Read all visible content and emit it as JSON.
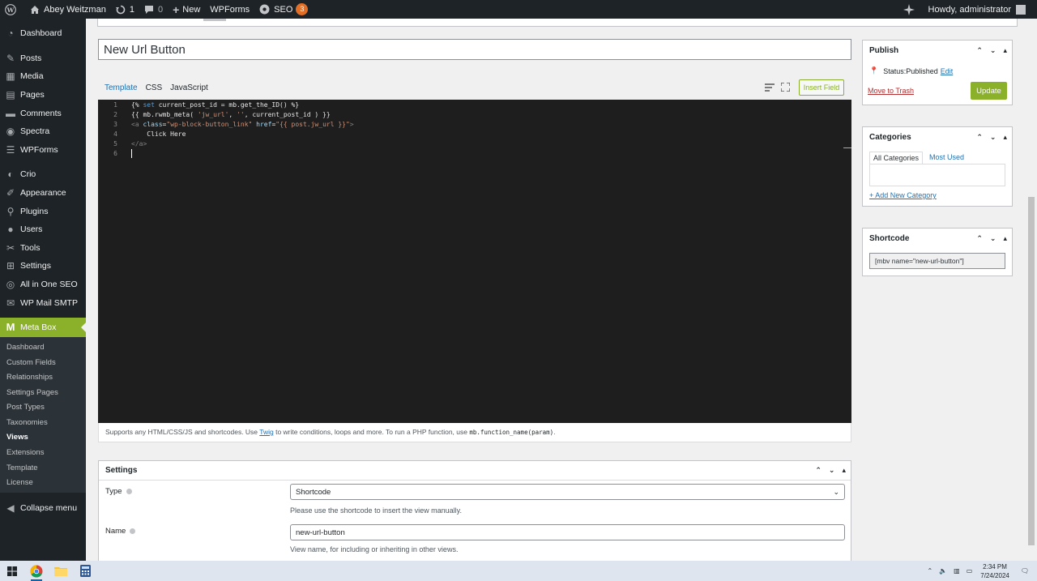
{
  "adminbar": {
    "site_name": "Abey Weitzman",
    "updates_count": "1",
    "comments_count": "0",
    "new_label": "New",
    "wpforms_label": "WPForms",
    "seo_label": "SEO",
    "seo_count": "3",
    "howdy": "Howdy, administrator"
  },
  "sidebar": {
    "items": [
      {
        "label": "Dashboard",
        "icon": "dashboard-icon"
      },
      {
        "label": "Posts",
        "icon": "pin-icon"
      },
      {
        "label": "Media",
        "icon": "media-icon"
      },
      {
        "label": "Pages",
        "icon": "page-icon"
      },
      {
        "label": "Comments",
        "icon": "comment-icon"
      },
      {
        "label": "Spectra",
        "icon": "spectra-icon"
      },
      {
        "label": "WPForms",
        "icon": "form-icon"
      },
      {
        "label": "Crio",
        "icon": "crio-icon"
      },
      {
        "label": "Appearance",
        "icon": "brush-icon"
      },
      {
        "label": "Plugins",
        "icon": "plugin-icon"
      },
      {
        "label": "Users",
        "icon": "users-icon"
      },
      {
        "label": "Tools",
        "icon": "tools-icon"
      },
      {
        "label": "Settings",
        "icon": "settings-icon"
      },
      {
        "label": "All in One SEO",
        "icon": "seo-icon"
      },
      {
        "label": "WP Mail SMTP",
        "icon": "mail-icon"
      }
    ],
    "current": {
      "label": "Meta Box",
      "icon": "M"
    },
    "submenu": [
      "Dashboard",
      "Custom Fields",
      "Relationships",
      "Settings Pages",
      "Post Types",
      "Taxonomies",
      "Views",
      "Extensions",
      "Template",
      "License"
    ],
    "submenu_current": "Views",
    "collapse_label": "Collapse menu"
  },
  "editor": {
    "title_value": "New Url Button",
    "tabs": [
      "Template",
      "CSS",
      "JavaScript"
    ],
    "active_tab": "Template",
    "insert_field_label": "Insert Field",
    "code_lines": [
      "{% set current_post_id = mb.get_the_ID() %}",
      "{{ mb.rwmb_meta( 'jw_url', '', current_post_id ) }}",
      "<a class=\"wp-block-button_link\" href=\"{{ post.jw_url }}\">",
      "    Click Here",
      "</a>",
      ""
    ],
    "help_prefix": "Supports any HTML/CSS/JS and shortcodes. Use ",
    "help_link": "Twig",
    "help_middle": " to write conditions, loops and more. To run a PHP function, use ",
    "help_code": "mb.function_name(param)",
    "help_suffix": "."
  },
  "settings": {
    "title": "Settings",
    "type_label": "Type",
    "type_value": "Shortcode",
    "type_desc": "Please use the shortcode to insert the view manually.",
    "name_label": "Name",
    "name_value": "new-url-button",
    "name_desc": "View name, for including or inheriting in other views."
  },
  "publish": {
    "title": "Publish",
    "status_label": "Status: ",
    "status_value": "Published",
    "edit_label": "Edit",
    "trash_label": "Move to Trash",
    "update_label": "Update"
  },
  "categories": {
    "title": "Categories",
    "tab_all": "All Categories",
    "tab_most": "Most Used",
    "add_label": "+ Add New Category"
  },
  "shortcode": {
    "title": "Shortcode",
    "value": "[mbv name=\"new-url-button\"]"
  },
  "taskbar": {
    "time": "2:34 PM",
    "date": "7/24/2024"
  },
  "colors": {
    "accent": "#8bb02a",
    "adminbar": "#1d2327",
    "link": "#2271b1"
  }
}
